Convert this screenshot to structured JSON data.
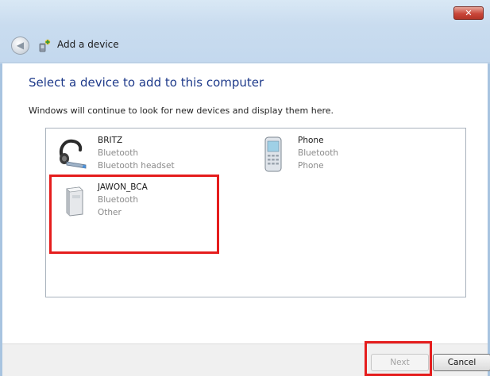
{
  "window": {
    "close_label": "✕",
    "back_icon": "back-arrow-icon",
    "title": "Add a device"
  },
  "main": {
    "heading": "Select a device to add to this computer",
    "instruction": "Windows will continue to look for new devices and display them here."
  },
  "devices": [
    {
      "name": "BRITZ",
      "type": "Bluetooth",
      "category": "Bluetooth headset",
      "icon": "headset-icon"
    },
    {
      "name": "Phone",
      "type": "Bluetooth",
      "category": "Phone",
      "icon": "phone-icon"
    },
    {
      "name": "JAWON_BCA",
      "type": "Bluetooth",
      "category": "Other",
      "icon": "generic-device-icon"
    }
  ],
  "buttons": {
    "next": "Next",
    "cancel": "Cancel"
  },
  "colors": {
    "accent": "#1e3a8a",
    "highlight": "#e51d1d"
  }
}
